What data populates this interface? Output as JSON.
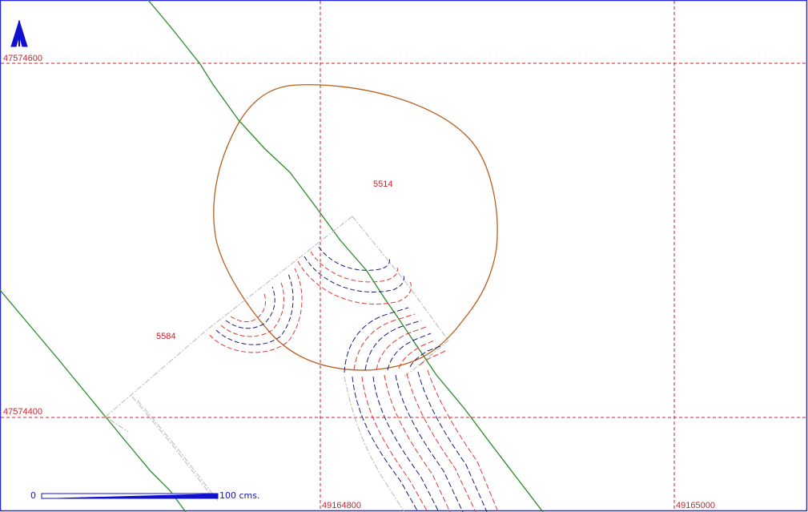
{
  "map": {
    "grid_labels": {
      "northing_top": "47574600",
      "northing_bottom": "47574400",
      "easting_left": "49164800",
      "easting_right": "49165000"
    },
    "parcels": [
      {
        "id": "5514"
      },
      {
        "id": "5584"
      }
    ],
    "scale_bar": {
      "start_label": "0",
      "end_label": "100 cms."
    },
    "colors": {
      "grid": "#d0202a",
      "frame": "#2a2ad8",
      "boundary": "#b86020",
      "road": "#2a8a2a",
      "contour_red": "#e03838",
      "contour_blue": "#1a1a7a",
      "outline": "#b8b8b8",
      "north_arrow": "#1010d0"
    },
    "icons": [
      "north-arrow-icon"
    ]
  }
}
